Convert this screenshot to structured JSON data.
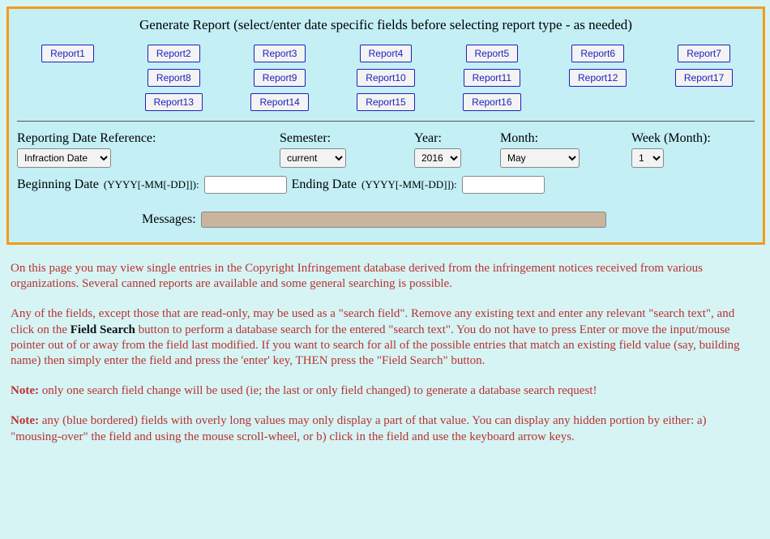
{
  "panel": {
    "title": "Generate Report (select/enter date specific fields before selecting report type - as needed)"
  },
  "reports": {
    "row1": [
      "Report1",
      "Report2",
      "Report3",
      "Report4",
      "Report5",
      "Report6",
      "Report7"
    ],
    "row2": [
      "",
      "Report8",
      "Report9",
      "Report10",
      "Report11",
      "Report12",
      "Report17"
    ],
    "row3": [
      "",
      "Report13",
      "Report14",
      "Report15",
      "Report16",
      "",
      ""
    ]
  },
  "filters": {
    "ref_label": "Reporting Date Reference:",
    "ref_value": "Infraction Date",
    "sem_label": "Semester:",
    "sem_value": "current",
    "year_label": "Year:",
    "year_value": "2016",
    "month_label": "Month:",
    "month_value": "May",
    "week_label": "Week (Month):",
    "week_value": "1",
    "begin_label": "Beginning Date",
    "begin_hint": "(YYYY[-MM[-DD]]):",
    "begin_value": "",
    "end_label": "Ending Date",
    "end_hint": "(YYYY[-MM[-DD]]):",
    "end_value": "",
    "messages_label": "Messages:",
    "messages_value": ""
  },
  "body": {
    "p1": "On this page you may view single entries in the Copyright Infringement database derived from the infringement notices received from various organizations. Several canned reports are available and some general searching is possible.",
    "p2a": "Any of the fields, except those that are read-only, may be used as a \"search field\". Remove any existing text and enter any relevant \"search text\", and click on the ",
    "p2_fieldsearch": "Field Search",
    "p2b": " button to perform a database search for the entered \"search text\". You do not have to press Enter or move the input/mouse pointer out of or away from the field last modified. If you want to search for all of the possible entries that match an existing field value (say, building name) then simply enter the field and press the 'enter' key, THEN press the \"Field Search\" button.",
    "note_label": "Note:",
    "p3": " only one search field change will be used (ie; the last or only field changed) to generate a database search request!",
    "p4": " any (blue bordered) fields with overly long values may only display a part of that value. You can display any hidden portion by either: a) \"mousing-over\" the field and using the mouse scroll-wheel, or b) click in the field and use the keyboard arrow keys."
  }
}
